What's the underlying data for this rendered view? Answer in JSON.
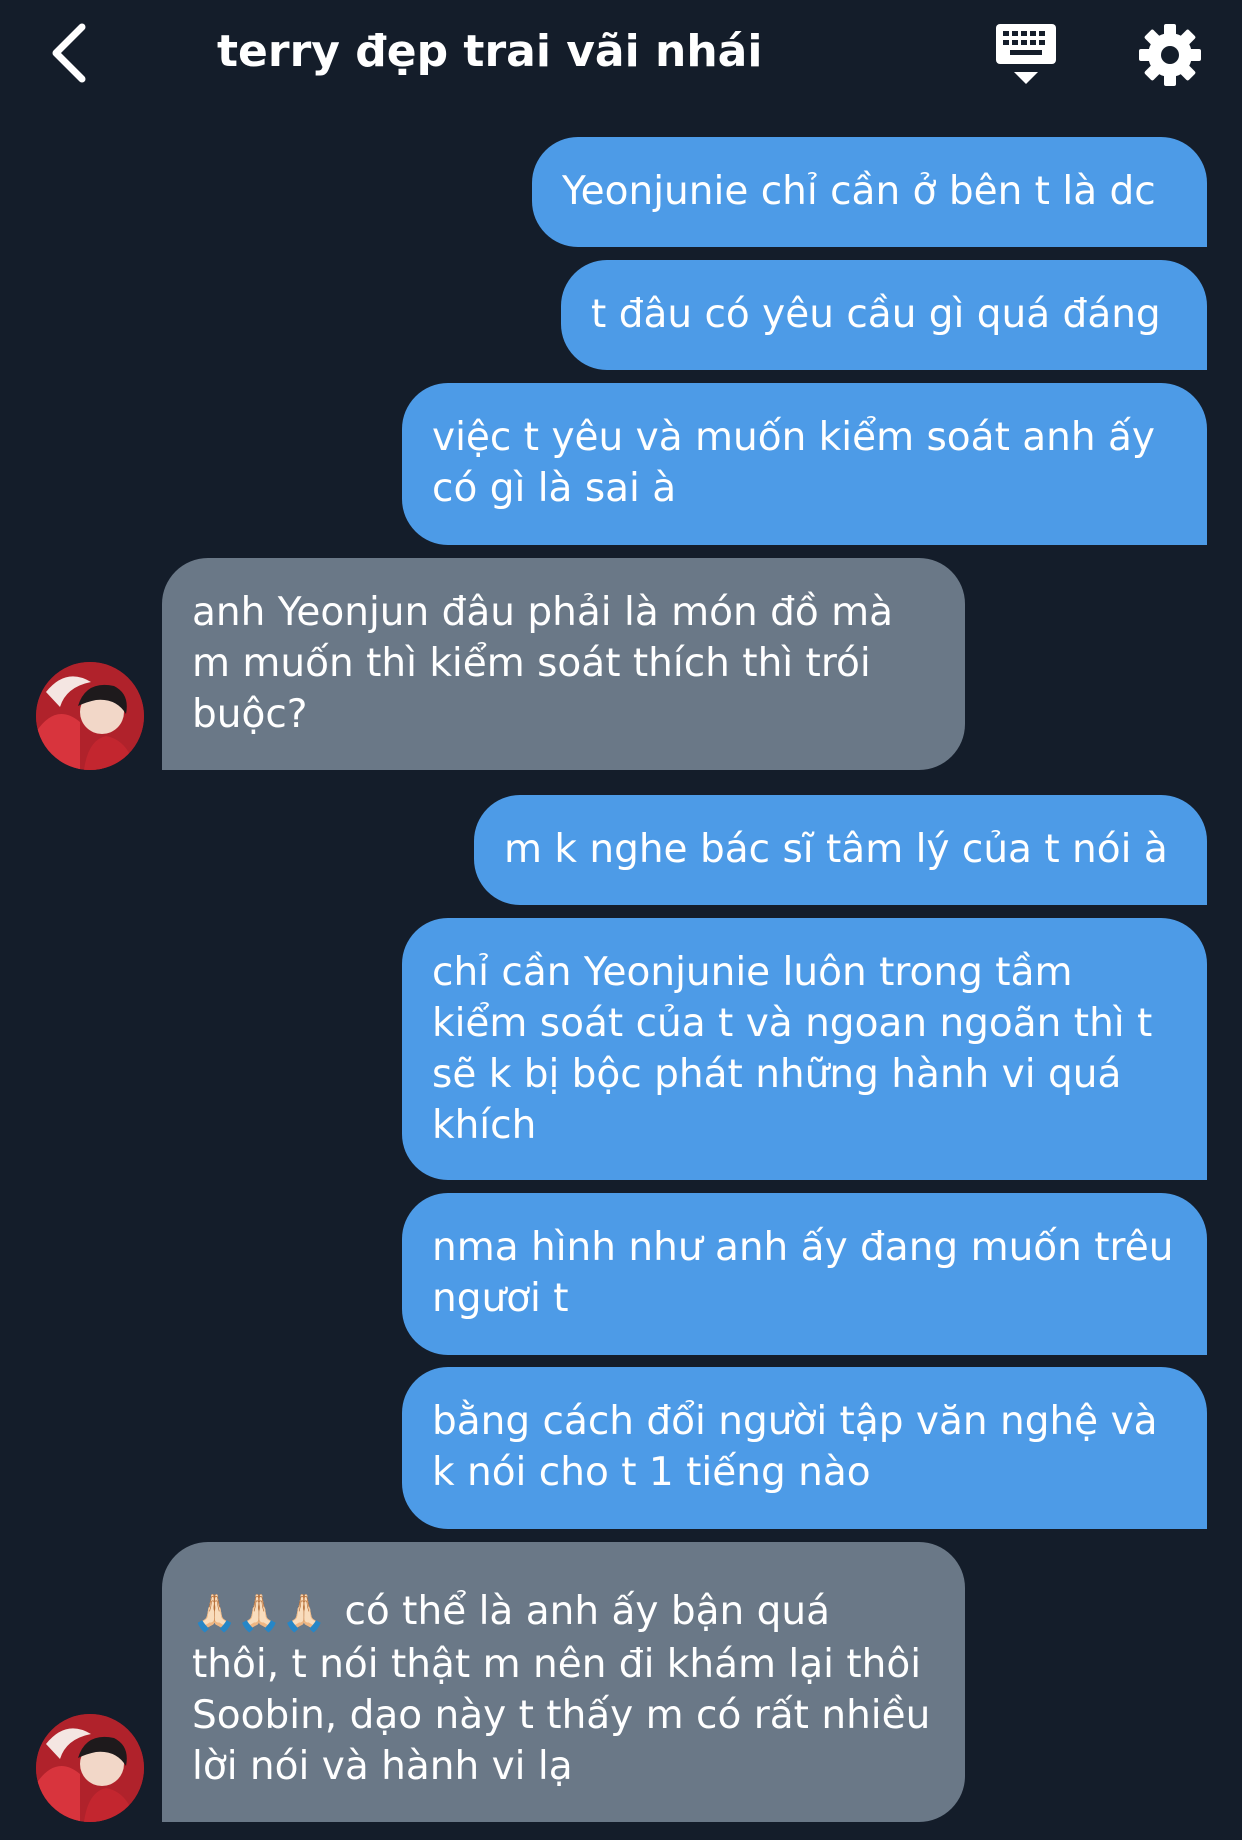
{
  "header": {
    "title": "terry đẹp trai vãi nhái",
    "back_icon": "chevron-left-icon",
    "keyboard_icon": "keyboard-icon",
    "settings_icon": "gear-icon"
  },
  "colors": {
    "background": "#141d2a",
    "sent_bubble": "#4d9be7",
    "received_bubble": "#6a7887",
    "text": "#ffffff"
  },
  "messages": [
    {
      "from": "me",
      "lines": [
        "Yeonjunie chỉ cần ở bên t là dc"
      ]
    },
    {
      "from": "me",
      "lines": [
        "t đâu có yêu cầu gì quá đáng"
      ]
    },
    {
      "from": "me",
      "lines": [
        "việc t yêu và muốn kiểm soát anh ấy",
        "có gì là sai à"
      ]
    },
    {
      "from": "them",
      "lines": [
        "anh Yeonjun đâu phải là món đồ mà",
        "m muốn thì kiểm soát thích thì trói",
        "buộc?"
      ]
    },
    {
      "from": "me",
      "lines": [
        "m k nghe bác sĩ tâm lý của t nói à"
      ]
    },
    {
      "from": "me",
      "lines": [
        "chỉ cần Yeonjunie luôn trong tầm",
        "kiểm soát của t và ngoan ngoãn thì t",
        "sẽ k bị bộc phát những hành vi quá",
        "khích"
      ]
    },
    {
      "from": "me",
      "lines": [
        "nma hình như anh ấy đang muốn trêu",
        "ngươi t"
      ]
    },
    {
      "from": "me",
      "lines": [
        "bằng cách đổi người tập văn nghệ và",
        "k nói cho t 1 tiếng nào"
      ]
    },
    {
      "from": "them",
      "emoji": "🙏🏻🙏🏻🙏🏻",
      "lines": [
        "có thể là anh ấy bận quá",
        "thôi, t nói thật m nên đi khám lại thôi",
        "Soobin, dạo này t thấy m có rất nhiều",
        "lời nói và hành vi lạ"
      ]
    }
  ]
}
